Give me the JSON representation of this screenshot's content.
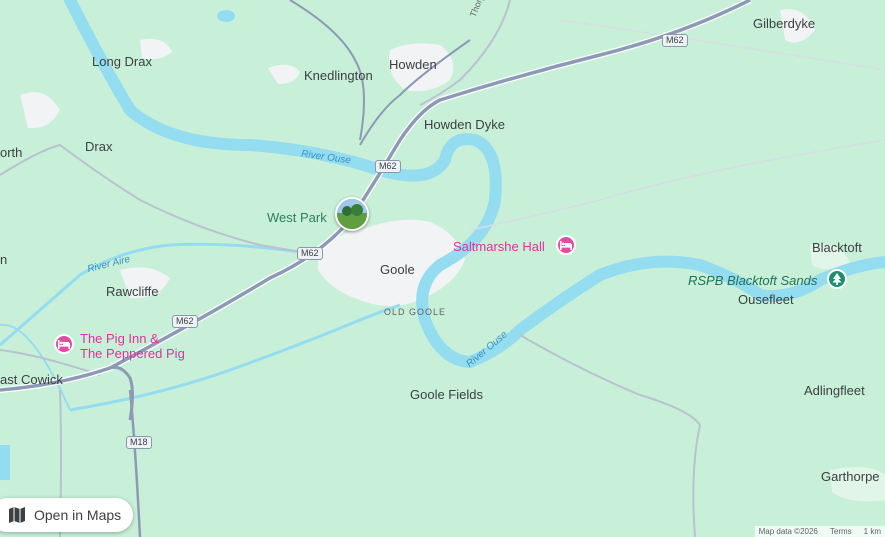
{
  "colors": {
    "land": "#c8f0d8",
    "water": "#94dcf0",
    "urban": "#f1f3f4",
    "motorway": "#8d9ab5",
    "road": "#b9c2cf",
    "poi": "#d8359a"
  },
  "places": [
    {
      "id": "long-drax",
      "text": "Long Drax"
    },
    {
      "id": "knedlington",
      "text": "Knedlington"
    },
    {
      "id": "howden",
      "text": "Howden"
    },
    {
      "id": "gilberdyke",
      "text": "Gilberdyke"
    },
    {
      "id": "north",
      "text": "orth"
    },
    {
      "id": "drax",
      "text": "Drax"
    },
    {
      "id": "howden-dyke",
      "text": "Howden Dyke"
    },
    {
      "id": "goole",
      "text": "Goole"
    },
    {
      "id": "blacktoft",
      "text": "Blacktoft"
    },
    {
      "id": "n-left",
      "text": "n"
    },
    {
      "id": "rawcliffe",
      "text": "Rawcliffe"
    },
    {
      "id": "ousefleet",
      "text": "Ousefleet"
    },
    {
      "id": "east-cowick",
      "text": "ast Cowick"
    },
    {
      "id": "goole-fields",
      "text": "Goole Fields"
    },
    {
      "id": "adlingfleet",
      "text": "Adlingfleet"
    },
    {
      "id": "garthorpe",
      "text": "Garthorpe"
    }
  ],
  "park": {
    "text": "West Park"
  },
  "district": {
    "text": "OLD GOOLE"
  },
  "road_label": {
    "text": "Thorpe Rd"
  },
  "rivers": [
    {
      "id": "ouse-west",
      "text": "River Ouse"
    },
    {
      "id": "aire",
      "text": "River Aire"
    },
    {
      "id": "ouse-south",
      "text": "River Ouse"
    }
  ],
  "pois": [
    {
      "id": "saltmarshe",
      "text": "Saltmarshe Hall",
      "icon": "hotel-icon"
    },
    {
      "id": "pig-inn",
      "text": "The Pig Inn &",
      "text2": "The Peppered Pig",
      "icon": "hotel-icon"
    }
  ],
  "reserve": {
    "text": "RSPB Blacktoft Sands",
    "icon": "tree-icon"
  },
  "shields": [
    {
      "id": "m62-top",
      "text": "M62"
    },
    {
      "id": "m62-mid",
      "text": "M62"
    },
    {
      "id": "m62-goole",
      "text": "M62"
    },
    {
      "id": "m62-left",
      "text": "M62"
    },
    {
      "id": "m18",
      "text": "M18"
    }
  ],
  "open_maps": {
    "label": "Open in Maps",
    "icon": "map-icon"
  },
  "attribution": {
    "data": "Map data ©2026",
    "terms": "Terms",
    "scale": "1 km"
  }
}
